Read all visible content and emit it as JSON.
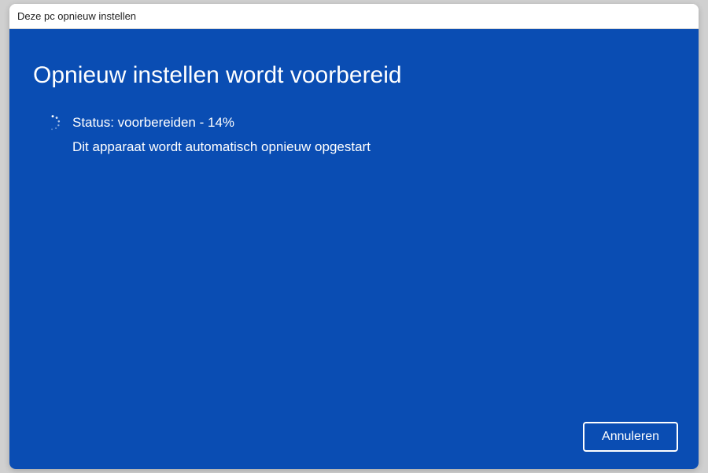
{
  "window": {
    "title": "Deze pc opnieuw instellen"
  },
  "dialog": {
    "heading": "Opnieuw instellen wordt voorbereid",
    "status_text": "Status: voorbereiden - 14%",
    "info_text": "Dit apparaat wordt automatisch opnieuw opgestart",
    "cancel_label": "Annuleren"
  },
  "colors": {
    "dialog_bg": "#0a4db3",
    "titlebar_bg": "#ffffff"
  }
}
